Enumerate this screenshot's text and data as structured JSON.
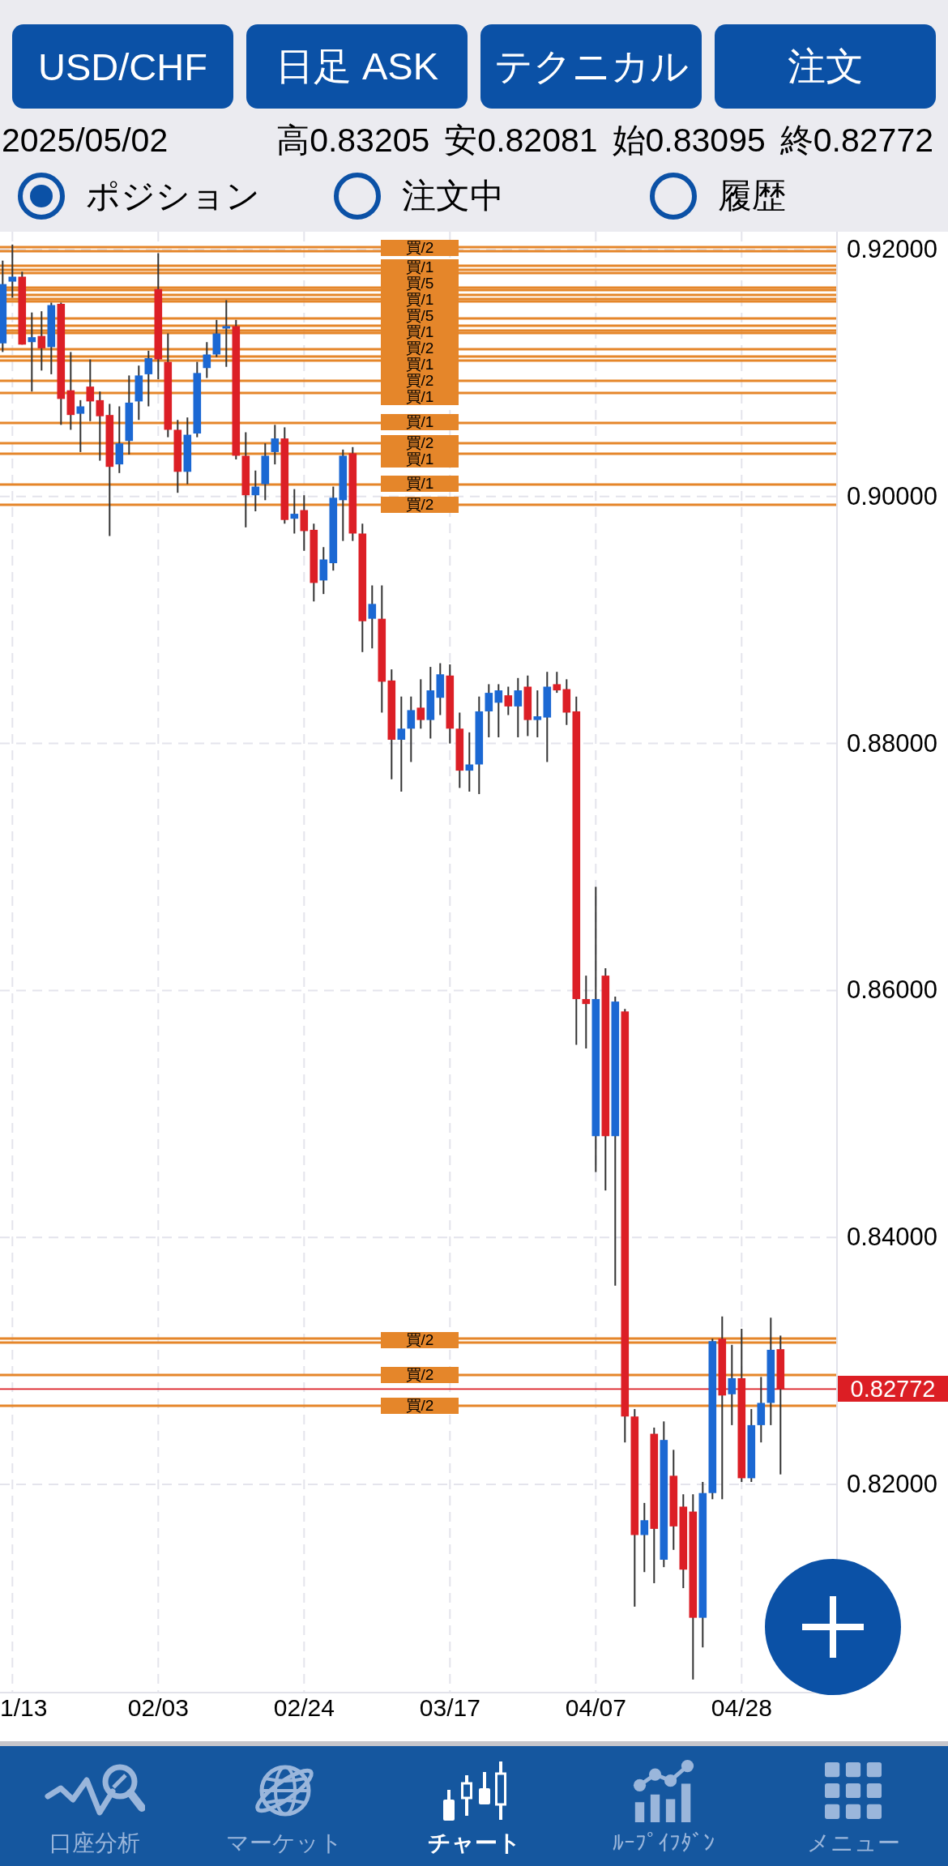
{
  "toolbar": {
    "buttons": [
      {
        "label": "USD/CHF"
      },
      {
        "label": "日足 ASK"
      },
      {
        "label": "テクニカル"
      },
      {
        "label": "注文"
      }
    ]
  },
  "quote": {
    "date": "2025/05/02",
    "values": [
      "高0.83205",
      "安0.82081",
      "始0.83095",
      "終0.82772"
    ]
  },
  "filter": [
    {
      "label": "ポジション",
      "selected": true
    },
    {
      "label": "注文中",
      "selected": false
    },
    {
      "label": "履歴",
      "selected": false
    }
  ],
  "chart": {
    "chart_data": {
      "type": "candlestick",
      "grid": true,
      "categories": [
        null,
        "1/13",
        null,
        null,
        null,
        null,
        null,
        null,
        null,
        null,
        null,
        null,
        null,
        null,
        null,
        null,
        "02/03",
        null,
        null,
        null,
        null,
        null,
        null,
        null,
        null,
        null,
        null,
        null,
        null,
        null,
        null,
        "02/24",
        null,
        null,
        null,
        null,
        null,
        null,
        null,
        null,
        null,
        null,
        null,
        null,
        null,
        null,
        "03/17",
        null,
        null,
        null,
        null,
        null,
        null,
        null,
        null,
        null,
        null,
        null,
        null,
        null,
        null,
        "04/07",
        null,
        null,
        null,
        null,
        null,
        null,
        null,
        null,
        null,
        null,
        null,
        null,
        null,
        null,
        "04/28",
        null,
        null,
        null,
        null
      ],
      "ohlc": [
        [
          0.9124,
          0.9191,
          0.9117,
          0.9172
        ],
        [
          0.9174,
          0.9204,
          0.9161,
          0.9178
        ],
        [
          0.9178,
          0.9182,
          0.9123,
          0.9123
        ],
        [
          0.9125,
          0.9149,
          0.9085,
          0.9129
        ],
        [
          0.913,
          0.915,
          0.9102,
          0.912
        ],
        [
          0.9121,
          0.9157,
          0.9099,
          0.9155
        ],
        [
          0.9156,
          0.9157,
          0.9058,
          0.9079
        ],
        [
          0.9086,
          0.9117,
          0.9054,
          0.9066
        ],
        [
          0.9067,
          0.9078,
          0.9036,
          0.9073
        ],
        [
          0.9089,
          0.9111,
          0.9061,
          0.9077
        ],
        [
          0.9078,
          0.9085,
          0.9029,
          0.9065
        ],
        [
          0.9066,
          0.9075,
          0.8968,
          0.9024
        ],
        [
          0.9026,
          0.9073,
          0.9019,
          0.9043
        ],
        [
          0.9045,
          0.9098,
          0.9034,
          0.9076
        ],
        [
          0.9077,
          0.9106,
          0.9062,
          0.9098
        ],
        [
          0.9099,
          0.9118,
          0.9073,
          0.9112
        ],
        [
          0.9168,
          0.9197,
          0.9095,
          0.9111
        ],
        [
          0.9109,
          0.9132,
          0.9048,
          0.9054
        ],
        [
          0.9054,
          0.9062,
          0.9003,
          0.902
        ],
        [
          0.902,
          0.9064,
          0.901,
          0.905
        ],
        [
          0.9051,
          0.9109,
          0.9048,
          0.91
        ],
        [
          0.9104,
          0.9125,
          0.9096,
          0.9115
        ],
        [
          0.9115,
          0.9143,
          0.9113,
          0.9132
        ],
        [
          0.9136,
          0.9159,
          0.9105,
          0.9138
        ],
        [
          0.9138,
          0.9143,
          0.903,
          0.9033
        ],
        [
          0.9033,
          0.9052,
          0.8975,
          0.9001
        ],
        [
          0.9001,
          0.9021,
          0.8988,
          0.9008
        ],
        [
          0.901,
          0.9043,
          0.8997,
          0.9033
        ],
        [
          0.9036,
          0.9058,
          0.9026,
          0.9047
        ],
        [
          0.9047,
          0.9056,
          0.8978,
          0.8981
        ],
        [
          0.8982,
          0.9006,
          0.897,
          0.8986
        ],
        [
          0.8989,
          0.9001,
          0.8956,
          0.8972
        ],
        [
          0.8973,
          0.8978,
          0.8915,
          0.893
        ],
        [
          0.8932,
          0.8959,
          0.8921,
          0.8949
        ],
        [
          0.8946,
          0.9008,
          0.894,
          0.8999
        ],
        [
          0.8997,
          0.9038,
          0.8964,
          0.9033
        ],
        [
          0.9035,
          0.904,
          0.8964,
          0.897
        ],
        [
          0.897,
          0.8978,
          0.8874,
          0.8899
        ],
        [
          0.8901,
          0.8928,
          0.8877,
          0.8913
        ],
        [
          0.8901,
          0.8928,
          0.8825,
          0.885
        ],
        [
          0.8851,
          0.886,
          0.8771,
          0.8803
        ],
        [
          0.8803,
          0.8838,
          0.8761,
          0.8812
        ],
        [
          0.8812,
          0.8838,
          0.8785,
          0.8827
        ],
        [
          0.8829,
          0.8852,
          0.8812,
          0.8819
        ],
        [
          0.8819,
          0.8862,
          0.8804,
          0.8843
        ],
        [
          0.8837,
          0.8865,
          0.8823,
          0.8856
        ],
        [
          0.8855,
          0.8864,
          0.88,
          0.8812
        ],
        [
          0.8812,
          0.8825,
          0.8764,
          0.8778
        ],
        [
          0.8778,
          0.8809,
          0.8761,
          0.8783
        ],
        [
          0.8783,
          0.8838,
          0.8759,
          0.8826
        ],
        [
          0.8826,
          0.8848,
          0.8805,
          0.8841
        ],
        [
          0.8833,
          0.8848,
          0.8805,
          0.8843
        ],
        [
          0.8839,
          0.8846,
          0.8823,
          0.883
        ],
        [
          0.883,
          0.8853,
          0.8805,
          0.8843
        ],
        [
          0.8846,
          0.8855,
          0.8806,
          0.8819
        ],
        [
          0.8819,
          0.8843,
          0.8805,
          0.8822
        ],
        [
          0.8821,
          0.8858,
          0.8785,
          0.8846
        ],
        [
          0.8848,
          0.8858,
          0.8841,
          0.8843
        ],
        [
          0.8844,
          0.8852,
          0.8815,
          0.8825
        ],
        [
          0.8826,
          0.8838,
          0.8556,
          0.8593
        ],
        [
          0.8593,
          0.8612,
          0.8553,
          0.8589
        ],
        [
          0.8482,
          0.8684,
          0.8453,
          0.8593
        ],
        [
          0.8612,
          0.8618,
          0.8438,
          0.8482
        ],
        [
          0.8482,
          0.8595,
          0.8361,
          0.8591
        ],
        [
          0.8583,
          0.8585,
          0.8234,
          0.8255
        ],
        [
          0.8255,
          0.8261,
          0.8101,
          0.8159
        ],
        [
          0.8159,
          0.8185,
          0.8129,
          0.8171
        ],
        [
          0.8241,
          0.8246,
          0.812,
          0.8164
        ],
        [
          0.8139,
          0.8251,
          0.8133,
          0.8236
        ],
        [
          0.8207,
          0.8228,
          0.8147,
          0.8166
        ],
        [
          0.8182,
          0.8192,
          0.8116,
          0.8131
        ],
        [
          0.8178,
          0.8192,
          0.8042,
          0.8092
        ],
        [
          0.8092,
          0.8202,
          0.8068,
          0.8193
        ],
        [
          0.8193,
          0.8318,
          0.8188,
          0.8316
        ],
        [
          0.8318,
          0.8336,
          0.8188,
          0.8272
        ],
        [
          0.8273,
          0.8313,
          0.8248,
          0.8286
        ],
        [
          0.8286,
          0.8326,
          0.8202,
          0.8205
        ],
        [
          0.8205,
          0.8261,
          0.8202,
          0.8248
        ],
        [
          0.8248,
          0.8287,
          0.8234,
          0.8266
        ],
        [
          0.8266,
          0.8335,
          0.8248,
          0.8309
        ],
        [
          0.83095,
          0.83205,
          0.82081,
          0.82772
        ]
      ],
      "ylim": [
        0.80314,
        0.92144
      ],
      "yticks": [
        {
          "value": 0.92,
          "label": "0.92000"
        },
        {
          "value": 0.9,
          "label": "0.90000"
        },
        {
          "value": 0.88,
          "label": "0.88000"
        },
        {
          "value": 0.86,
          "label": "0.86000"
        },
        {
          "value": 0.84,
          "label": "0.84000"
        },
        {
          "value": 0.82,
          "label": "0.82000"
        }
      ],
      "ref_lines": [
        {
          "axis": "y",
          "value": 0.82772,
          "label": "0.82772",
          "color": "#dc1e24"
        }
      ]
    },
    "position_labels": [
      "買/2",
      "買/1",
      "買/5",
      "買/1",
      "買/5",
      "買/1",
      "買/2",
      "買/1",
      "買/2",
      "買/1",
      "買/1",
      "買/2",
      "買/1",
      "買/1",
      "買/2",
      "買/2",
      "買/2",
      "買/2"
    ]
  },
  "tabs": [
    {
      "label": "口座分析",
      "selected": false
    },
    {
      "label": "マーケット",
      "selected": false
    },
    {
      "label": "チャート",
      "selected": true
    },
    {
      "label": "ﾙｰﾌﾟｲﾌﾀﾞﾝ",
      "selected": false
    },
    {
      "label": "メニュー",
      "selected": false
    }
  ]
}
